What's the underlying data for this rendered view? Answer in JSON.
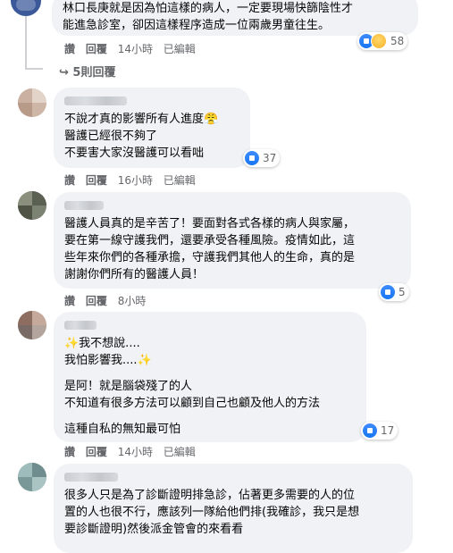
{
  "comment0": {
    "lines": [
      "林口長庚就是因為怕這樣的病人，一定要現場快篩陰性才",
      "能進急診室，卻因這樣程序造成一位兩歲男童往生。"
    ],
    "actions": {
      "like": "讚",
      "reply": "回覆",
      "time": "14小時",
      "edited": "已編輯"
    },
    "reaction_count": "58"
  },
  "replies_link": {
    "label": "5則回覆"
  },
  "comment1": {
    "lines": [
      "不說才真的影響所有人進度😤",
      "醫護已經很不夠了",
      "不要害大家沒醫護可以看咄"
    ],
    "actions": {
      "like": "讚",
      "reply": "回覆",
      "time": "16小時",
      "edited": "已編輯"
    },
    "reaction_count": "37"
  },
  "comment2": {
    "lines": [
      "醫護人員真的是辛苦了！要面對各式各樣的病人與家屬，",
      "要在第一線守護我們，還要承受各種風險。疫情如此，這",
      "些年來你們的各種承擔，守護我們其他人的生命，真的是",
      "謝謝你們所有的醫護人員！"
    ],
    "actions": {
      "like": "讚",
      "reply": "回覆",
      "time": "8小時"
    },
    "reaction_count": "5"
  },
  "comment3": {
    "lines_a": [
      "✨我不想說....",
      "我怕影響我....✨"
    ],
    "lines_b": [
      "是阿！就是腦袋殘了的人",
      "不知道有很多方法可以顧到自己也顧及他人的方法"
    ],
    "lines_c": [
      "這種自私的無知最可怕"
    ],
    "actions": {
      "like": "讚",
      "reply": "回覆",
      "time": "14小時",
      "edited": "已編輯"
    },
    "reaction_count": "17"
  },
  "comment4": {
    "lines": [
      "很多人只是為了診斷證明排急診，佔著更多需要的人的位",
      "置的人也很不行，應該列一隊給他們排(我確診，我只是想",
      "要診斷證明)然後派金管會的來看看"
    ]
  },
  "colors": {
    "like_blue": "#1877f2",
    "bubble_bg": "#f0f2f5",
    "meta_gray": "#65676b"
  }
}
